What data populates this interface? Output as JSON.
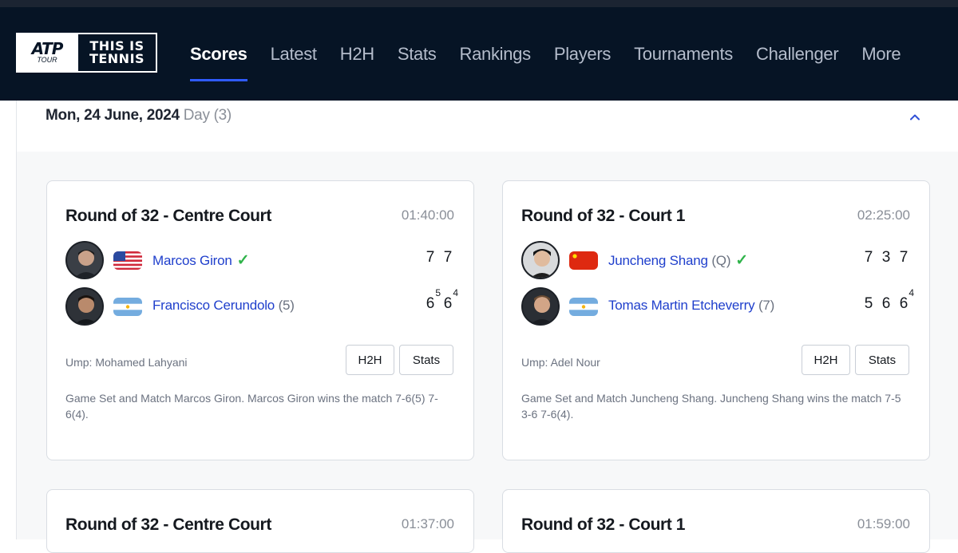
{
  "nav": {
    "logo": {
      "atp": "ATP",
      "tour": "TOUR",
      "line1": "THIS IS",
      "line2": "TENNIS"
    },
    "items": [
      {
        "label": "Scores",
        "active": true
      },
      {
        "label": "Latest"
      },
      {
        "label": "H2H"
      },
      {
        "label": "Stats"
      },
      {
        "label": "Rankings"
      },
      {
        "label": "Players"
      },
      {
        "label": "Tournaments"
      },
      {
        "label": "Challenger"
      },
      {
        "label": "More"
      }
    ]
  },
  "datebar": {
    "date": "Mon, 24 June, 2024",
    "day": "Day (3)"
  },
  "matches": [
    {
      "round": "Round of 32 - Centre Court",
      "duration": "01:40:00",
      "players": [
        {
          "name": "Marcos Giron",
          "seed": "",
          "flag": "USA",
          "winner": true,
          "scores": [
            {
              "v": "7"
            },
            {
              "v": "7"
            }
          ]
        },
        {
          "name": "Francisco Cerundolo",
          "seed": "(5)",
          "flag": "ARG",
          "winner": false,
          "scores": [
            {
              "v": "6",
              "tb": "5"
            },
            {
              "v": "6",
              "tb": "4"
            }
          ]
        }
      ],
      "umpire": "Ump: Mohamed Lahyani",
      "h2h_label": "H2H",
      "stats_label": "Stats",
      "summary": "Game Set and Match Marcos Giron. Marcos Giron wins the match 7-6(5) 7-6(4)."
    },
    {
      "round": "Round of 32 - Court 1",
      "duration": "02:25:00",
      "players": [
        {
          "name": "Juncheng Shang",
          "seed": "(Q)",
          "flag": "CHN",
          "winner": true,
          "scores": [
            {
              "v": "7"
            },
            {
              "v": "3"
            },
            {
              "v": "7"
            }
          ]
        },
        {
          "name": "Tomas Martin Etcheverry",
          "seed": "(7)",
          "flag": "ARG",
          "winner": false,
          "scores": [
            {
              "v": "5"
            },
            {
              "v": "6"
            },
            {
              "v": "6",
              "tb": "4"
            }
          ]
        }
      ],
      "umpire": "Ump: Adel Nour",
      "h2h_label": "H2H",
      "stats_label": "Stats",
      "summary": "Game Set and Match Juncheng Shang. Juncheng Shang wins the match 7-5 3-6 7-6(4)."
    },
    {
      "round": "Round of 32 - Centre Court",
      "duration": "01:37:00"
    },
    {
      "round": "Round of 32 - Court 1",
      "duration": "01:59:00"
    }
  ],
  "colors": {
    "nav_bg": "#061425",
    "accent": "#2f5bff",
    "link": "#1f3fcc",
    "check": "#2fb34a"
  }
}
